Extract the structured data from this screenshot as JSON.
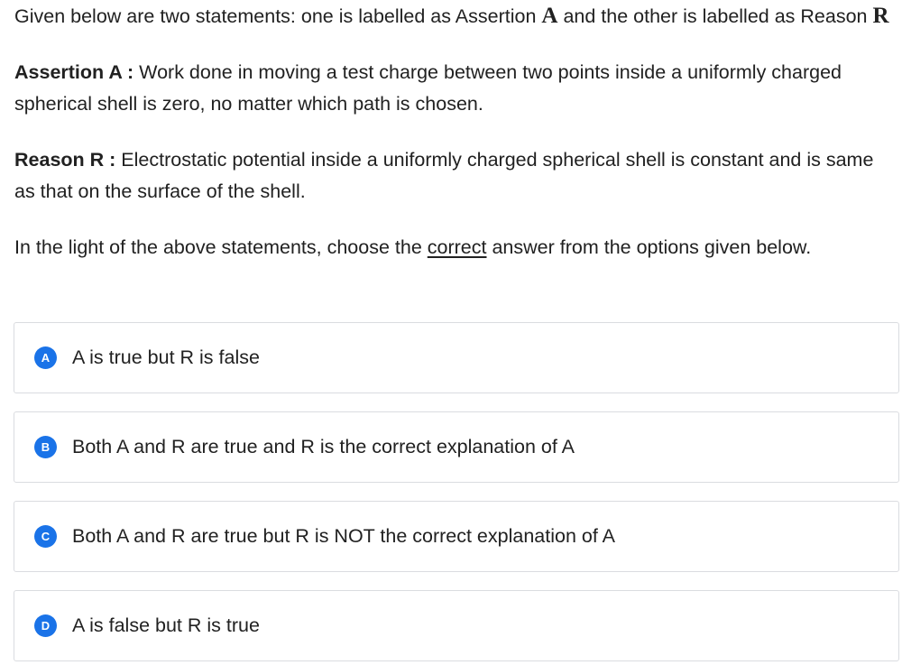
{
  "question": {
    "intro": {
      "text_before_a": "Given below are two statements: one is labelled as Assertion ",
      "symbol_a": "A",
      "text_between": " and the other is labelled as Reason ",
      "symbol_r": "R"
    },
    "assertion": {
      "label": "Assertion A :",
      "text": " Work done in moving a test charge between two points inside a uniformly charged spherical shell is zero, no matter which path is chosen."
    },
    "reason": {
      "label": "Reason R :",
      "text": " Electrostatic potential inside a uniformly charged spherical shell is constant and is same as that on the surface of the shell."
    },
    "instruction": {
      "before": "In the light of the above statements, choose the ",
      "emphasis": "correct",
      "after": " answer from the options given below."
    }
  },
  "options": [
    {
      "letter": "A",
      "text": "A is true but R is false"
    },
    {
      "letter": "B",
      "text": "Both A and R are true and R is the correct explanation of A"
    },
    {
      "letter": "C",
      "text": "Both A and R are true but R is NOT the correct explanation of A"
    },
    {
      "letter": "D",
      "text": "A is false but R is true"
    }
  ],
  "colors": {
    "badge": "#1a73e8",
    "text": "#212121",
    "border": "#dadce0"
  }
}
